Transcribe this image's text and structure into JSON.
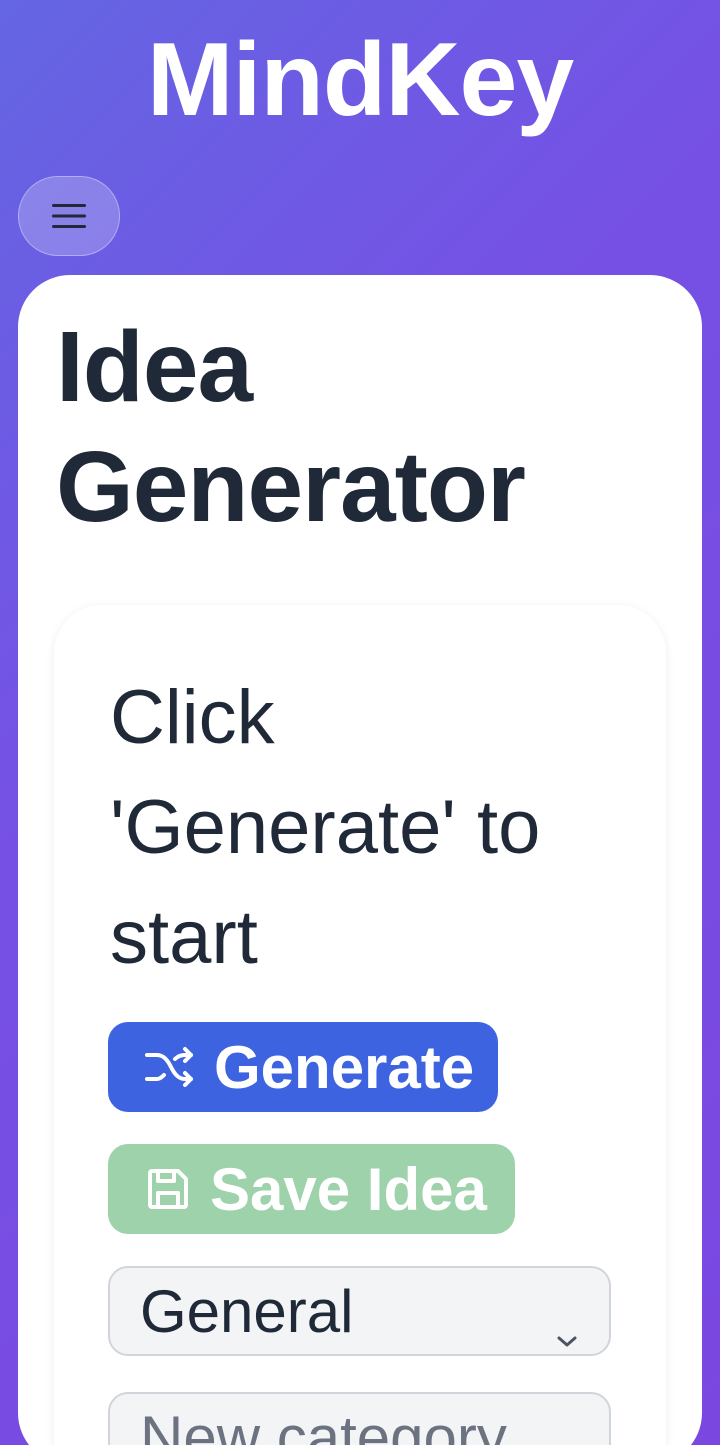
{
  "header": {
    "app_title": "MindKey",
    "menu_icon": "hamburger-menu-icon"
  },
  "main": {
    "page_title": "Idea Generator",
    "idea_text": "Click 'Generate' to start",
    "generate_button": {
      "label": "Generate",
      "icon": "shuffle-icon",
      "color": "#3d63e0"
    },
    "save_button": {
      "label": "Save Idea",
      "icon": "save-icon",
      "color": "#9ed2ab",
      "disabled": true
    },
    "category_select": {
      "selected": "General",
      "icon": "chevron-down-icon"
    },
    "new_category_input": {
      "placeholder": "New category",
      "value": ""
    }
  },
  "colors": {
    "background_gradient_start": "#6466e3",
    "background_gradient_end": "#7b47e1",
    "text_dark": "#1f2937"
  }
}
